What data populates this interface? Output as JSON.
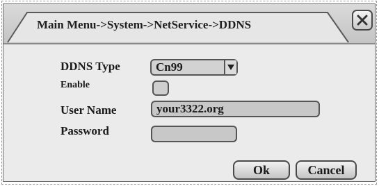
{
  "title": "Main Menu->System->NetService->DDNS",
  "close_icon": "close-icon",
  "form": {
    "ddns_type": {
      "label": "DDNS Type",
      "value": "Cn99",
      "arrow_icon": "dropdown-arrow-icon"
    },
    "enable": {
      "label": "Enable",
      "checked": false
    },
    "user_name": {
      "label": "User Name",
      "value": "your3322.org"
    },
    "password": {
      "label": "Password",
      "value": ""
    }
  },
  "buttons": {
    "ok": "Ok",
    "cancel": "Cancel"
  }
}
